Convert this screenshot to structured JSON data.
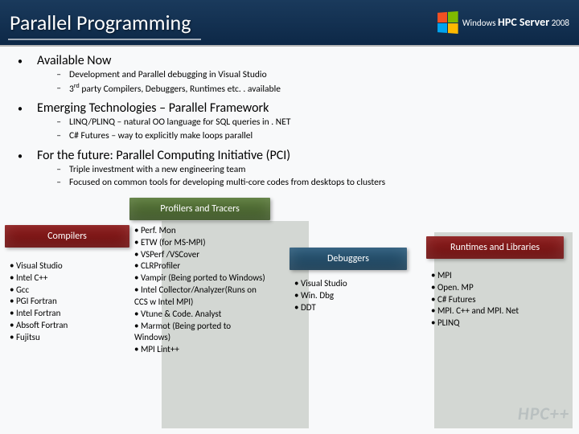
{
  "header": {
    "title": "Parallel Programming",
    "logo_line1": "Windows",
    "logo_line2": "HPC Server",
    "logo_year": "2008"
  },
  "sections": [
    {
      "title": "Available  Now",
      "subs": [
        "Development and Parallel debugging in Visual Studio",
        "3<sup>rd</sup> party Compilers, Debuggers, Runtimes etc. . available"
      ]
    },
    {
      "title": "Emerging Technologies – Parallel Framework",
      "subs": [
        "LINQ/PLINQ – natural OO language for SQL queries in . NET",
        "C# Futures – way to explicitly make loops parallel"
      ]
    },
    {
      "title": "For the future: Parallel Computing Initiative (PCI)",
      "subs": [
        "Triple investment with a new engineering team",
        "Focused on common tools for developing multi-core codes from desktops to clusters"
      ]
    }
  ],
  "cols": {
    "compilers": {
      "header": "Compilers",
      "items": [
        "Visual Studio",
        "Intel C++",
        "Gcc",
        "PGI Fortran",
        "Intel Fortran",
        "Absoft Fortran",
        "Fujitsu"
      ]
    },
    "profilers": {
      "header": "Profilers and Tracers",
      "items": [
        "Perf. Mon",
        "ETW (for MS-MPI)",
        "VSPerf /VSCover",
        "CLRProfiler",
        "Vampir (Being ported to Windows)",
        "Intel Collector/Analyzer(Runs on CCS w Intel MPI)",
        "Vtune & Code. Analyst",
        "Marmot (Being ported to Windows)",
        "MPI Lint++"
      ]
    },
    "debuggers": {
      "header": "Debuggers",
      "items": [
        "Visual Studio",
        "Win. Dbg",
        "DDT"
      ]
    },
    "runtimes": {
      "header": "Runtimes and Libraries",
      "items": [
        "MPI",
        "Open. MP",
        "C# Futures",
        "MPI. C++ and MPI. Net",
        "PLINQ"
      ]
    }
  },
  "watermark": "HPC++"
}
